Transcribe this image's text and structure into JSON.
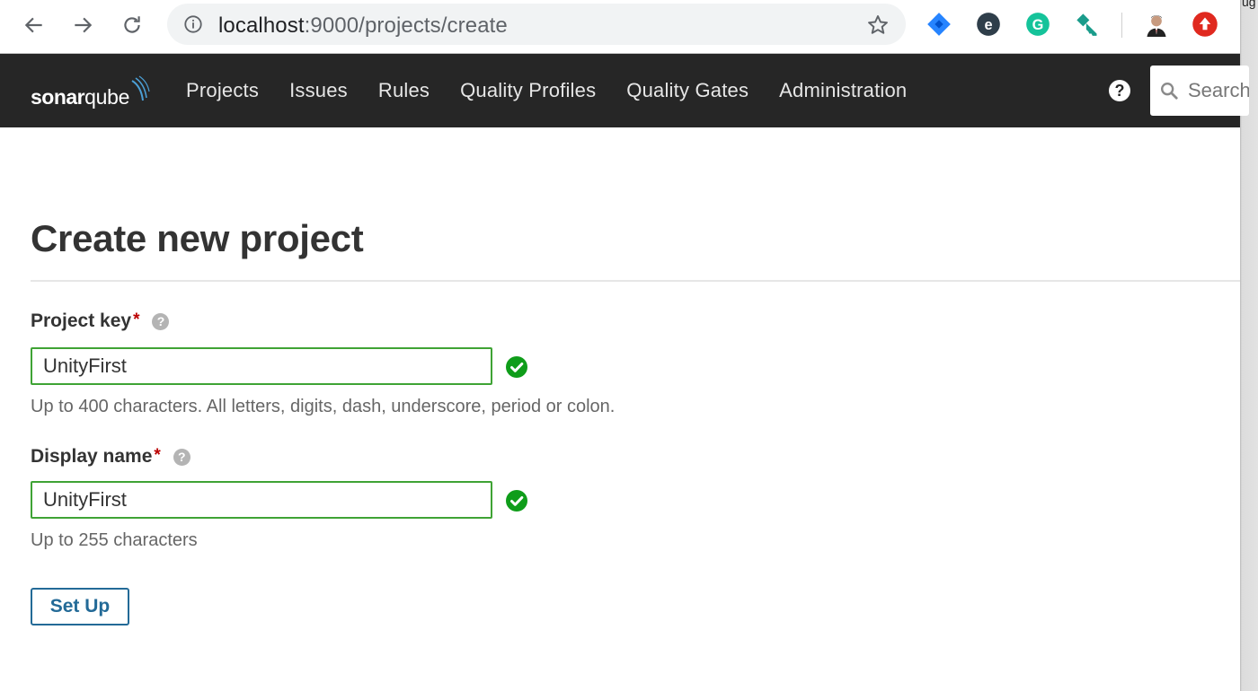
{
  "browser": {
    "url_host": "localhost",
    "url_rest": ":9000/projects/create",
    "extensions": [
      {
        "name": "jira-extension-icon",
        "color": "#2684ff"
      },
      {
        "name": "evernote-extension-icon",
        "color": "#2f3e4a"
      },
      {
        "name": "grammarly-extension-icon",
        "color": "#15c39a"
      },
      {
        "name": "key-extension-icon",
        "color": "#1a9c8b"
      },
      {
        "name": "profile-avatar",
        "color": "#6b4b3a"
      },
      {
        "name": "upload-extension-icon",
        "color": "#e0291f"
      }
    ]
  },
  "side_strip_fragment": "ug",
  "navbar": {
    "logo_bold": "sonar",
    "logo_light": "qube",
    "menu": [
      {
        "label": "Projects"
      },
      {
        "label": "Issues"
      },
      {
        "label": "Rules"
      },
      {
        "label": "Quality Profiles"
      },
      {
        "label": "Quality Gates"
      },
      {
        "label": "Administration"
      }
    ],
    "help_label": "?",
    "search_placeholder": "Search"
  },
  "page": {
    "title": "Create new project",
    "project_key": {
      "label": "Project key",
      "required_mark": "*",
      "value": "UnityFirst",
      "hint": "Up to 400 characters. All letters, digits, dash, underscore, period or colon."
    },
    "display_name": {
      "label": "Display name",
      "required_mark": "*",
      "value": "UnityFirst",
      "hint": "Up to 255 characters"
    },
    "help_glyph": "?",
    "submit_label": "Set Up"
  },
  "colors": {
    "navbar_bg": "#262626",
    "valid_green": "#3fa335",
    "button_blue": "#236a97",
    "required_red": "#bb0000"
  }
}
